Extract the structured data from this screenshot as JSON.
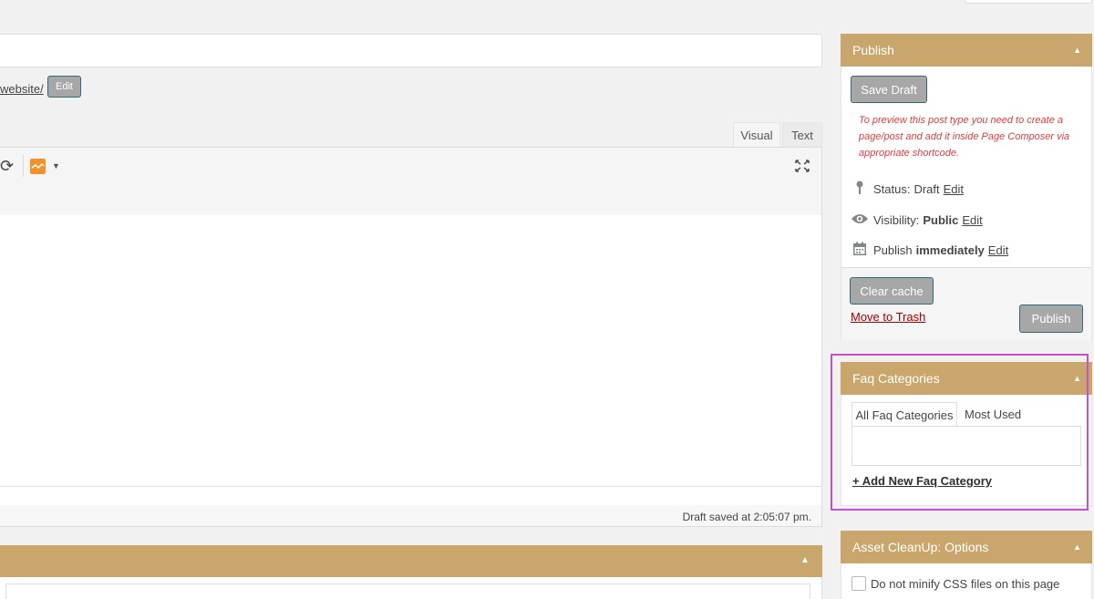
{
  "editor": {
    "permalink_text": "website/",
    "edit_slug_label": "Edit",
    "tabs": [
      {
        "label": "Visual"
      },
      {
        "label": "Text"
      }
    ],
    "toolbar": {
      "refresh_icon": "⟳",
      "caret_icon": "▼",
      "fullscreen_icon": "⛶"
    },
    "draft_saved_text": "Draft saved at 2:05:07 pm."
  },
  "publish_box": {
    "title": "Publish",
    "collapse_icon": "▲",
    "save_draft_label": "Save Draft",
    "preview_note": "To preview this post type you need to create a page/post and add it inside Page Composer via appropriate shortcode.",
    "status": {
      "label": "Status:",
      "value": "Draft",
      "edit": "Edit"
    },
    "visibility": {
      "label": "Visibility:",
      "value": "Public",
      "edit": "Edit"
    },
    "schedule": {
      "label": "Publish",
      "value": "immediately",
      "edit": "Edit"
    },
    "clear_cache_label": "Clear cache",
    "trash_label": "Move to Trash",
    "publish_label": "Publish"
  },
  "faq_categories": {
    "title": "Faq Categories",
    "collapse_icon": "▲",
    "tab_all": "All Faq Categories",
    "tab_most_used": "Most Used",
    "add_new": "+ Add New Faq Category"
  },
  "asset_cleanup": {
    "title": "Asset CleanUp: Options",
    "collapse_icon": "▲",
    "minify_css_label": "Do not minify CSS files on this page"
  },
  "colors": {
    "box_header": "#c9a66b",
    "highlight": "#c94ec9",
    "trash": "#aa0000",
    "preview_note": "#e53935"
  }
}
